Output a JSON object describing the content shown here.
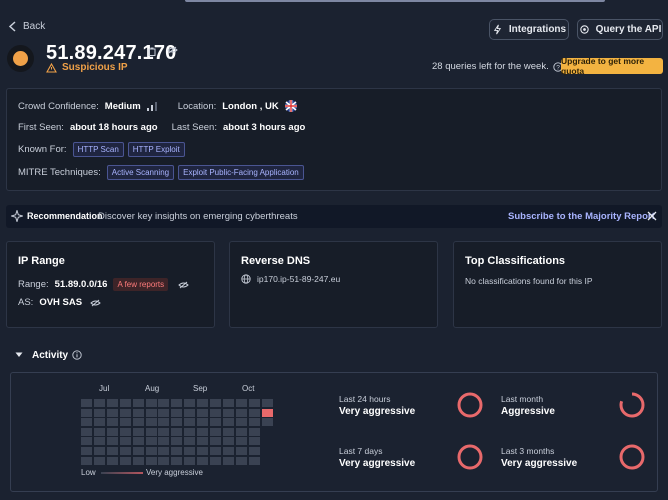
{
  "header": {
    "back_label": "Back",
    "integrations_label": "Integrations",
    "query_api_label": "Query the API",
    "ip": "51.89.247.170",
    "reputation": "Suspicious IP",
    "queries_left": "28 queries left for the week.",
    "upgrade_label": "Upgrade to get more quota"
  },
  "info": {
    "crowd_confidence_label": "Crowd Confidence:",
    "crowd_confidence_value": "Medium",
    "location_label": "Location:",
    "location_value": "London , UK",
    "first_seen_label": "First Seen:",
    "first_seen_value": "about 18 hours ago",
    "last_seen_label": "Last Seen:",
    "last_seen_value": "about 3 hours ago",
    "known_for_label": "Known For:",
    "known_for": [
      "HTTP Scan",
      "HTTP Exploit"
    ],
    "mitre_label": "MITRE Techniques:",
    "mitre": [
      "Active Scanning",
      "Exploit Public-Facing Application"
    ]
  },
  "recommendation": {
    "title": "Recommendation",
    "text": "Discover key insights on emerging cyberthreats",
    "link": "Subscribe to the Majority Report"
  },
  "ip_range": {
    "title": "IP Range",
    "range_label": "Range:",
    "range_value": "51.89.0.0/16",
    "reports_badge": "A few reports",
    "as_label": "AS:",
    "as_value": "OVH SAS"
  },
  "reverse_dns": {
    "title": "Reverse DNS",
    "value": "ip170.ip-51-89-247.eu"
  },
  "classifications": {
    "title": "Top Classifications",
    "empty": "No classifications found for this IP"
  },
  "activity": {
    "title": "Activity",
    "months": [
      "Jul",
      "Aug",
      "Sep",
      "Oct"
    ],
    "legend_low": "Low",
    "legend_high": "Very aggressive",
    "stats": [
      {
        "label": "Last 24 hours",
        "value": "Very aggressive",
        "fill": 1.0
      },
      {
        "label": "Last month",
        "value": "Aggressive",
        "fill": 0.8
      },
      {
        "label": "Last 7 days",
        "value": "Very aggressive",
        "fill": 1.0
      },
      {
        "label": "Last 3 months",
        "value": "Very aggressive",
        "fill": 1.0
      }
    ]
  },
  "colors": {
    "accent_orange": "#f0a148",
    "upgrade_yellow": "#f3b341",
    "aggressive_red": "#e8696b",
    "link_purple": "#a9b4ff"
  }
}
